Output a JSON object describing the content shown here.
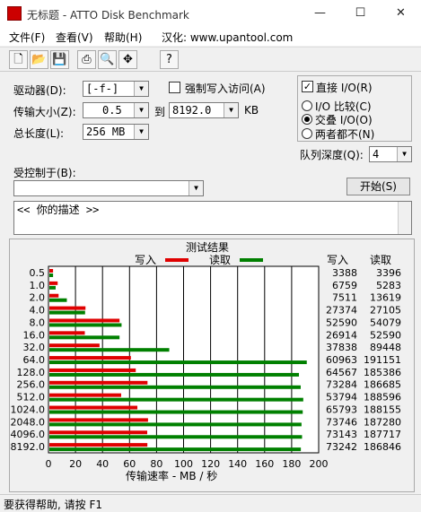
{
  "window": {
    "title": "无标题 - ATTO Disk Benchmark",
    "min_icon": "—",
    "max_icon": "☐",
    "close_icon": "✕"
  },
  "menu": {
    "items": [
      "文件(F)",
      "查看(V)",
      "帮助(H)",
      "汉化: www.upantool.com"
    ]
  },
  "toolbar": {
    "icons": [
      "new-file-icon",
      "open-folder-icon",
      "save-icon",
      "print-icon",
      "print-preview-icon",
      "move-icon",
      "help-pointer-icon"
    ]
  },
  "settings": {
    "drive_label": "驱动器(D):",
    "drive_value": "[-f-]",
    "force_write_label": "强制写入访问(A)",
    "direct_io_label": "直接 I/O(R)",
    "transfer_label": "传输大小(Z):",
    "transfer_from": "0.5",
    "to_label": "到",
    "transfer_to": "8192.0",
    "kb_label": "KB",
    "total_label": "总长度(L):",
    "total_value": "256 MB",
    "io_compare_label": "I/O 比较(C)",
    "overlap_io_label": "交叠 I/O(O)",
    "neither_label": "两者都不(N)",
    "queue_label": "队列深度(Q):",
    "queue_value": "4",
    "controlled_label": "受控制于(B):",
    "controlled_value": "",
    "start_button": "开始(S)",
    "description": "<<  你的描述   >>"
  },
  "results": {
    "title": "测试结果",
    "write_legend": "写入",
    "read_legend": "读取",
    "col_write": "写入",
    "col_read": "读取",
    "xlabel": "传输速率 - MB / 秒",
    "rows": [
      {
        "size": "0.5",
        "write": "3388",
        "read": "3396"
      },
      {
        "size": "1.0",
        "write": "6759",
        "read": "5283"
      },
      {
        "size": "2.0",
        "write": "7511",
        "read": "13619"
      },
      {
        "size": "4.0",
        "write": "27374",
        "read": "27105"
      },
      {
        "size": "8.0",
        "write": "52590",
        "read": "54079"
      },
      {
        "size": "16.0",
        "write": "26914",
        "read": "52590"
      },
      {
        "size": "32.0",
        "write": "37838",
        "read": "89448"
      },
      {
        "size": "64.0",
        "write": "60963",
        "read": "191151"
      },
      {
        "size": "128.0",
        "write": "64567",
        "read": "185386"
      },
      {
        "size": "256.0",
        "write": "73284",
        "read": "186685"
      },
      {
        "size": "512.0",
        "write": "53794",
        "read": "188596"
      },
      {
        "size": "1024.0",
        "write": "65793",
        "read": "188155"
      },
      {
        "size": "2048.0",
        "write": "73746",
        "read": "187280"
      },
      {
        "size": "4096.0",
        "write": "73143",
        "read": "187717"
      },
      {
        "size": "8192.0",
        "write": "73242",
        "read": "186846"
      }
    ]
  },
  "chart_data": {
    "type": "bar",
    "title": "测试结果",
    "xlabel": "传输速率 - MB / 秒",
    "ylabel": "",
    "xlim": [
      0,
      200
    ],
    "ticks": [
      "0",
      "20",
      "40",
      "60",
      "80",
      "100",
      "120",
      "140",
      "160",
      "180",
      "200"
    ],
    "categories": [
      "0.5",
      "1.0",
      "2.0",
      "4.0",
      "8.0",
      "16.0",
      "32.0",
      "64.0",
      "128.0",
      "256.0",
      "512.0",
      "1024.0",
      "2048.0",
      "4096.0",
      "8192.0"
    ],
    "series": [
      {
        "name": "写入",
        "color": "#e00000",
        "values": [
          3.4,
          6.8,
          7.5,
          27.4,
          52.6,
          26.9,
          37.8,
          61.0,
          64.6,
          73.3,
          53.8,
          65.8,
          73.7,
          73.1,
          73.2
        ]
      },
      {
        "name": "读取",
        "color": "#008000",
        "values": [
          3.4,
          5.3,
          13.6,
          27.1,
          54.1,
          52.6,
          89.4,
          191.2,
          185.4,
          186.7,
          188.6,
          188.2,
          187.3,
          187.7,
          186.8
        ]
      }
    ],
    "grid": true,
    "legend": "top"
  },
  "status": {
    "text": "要获得帮助, 请按 F1"
  }
}
